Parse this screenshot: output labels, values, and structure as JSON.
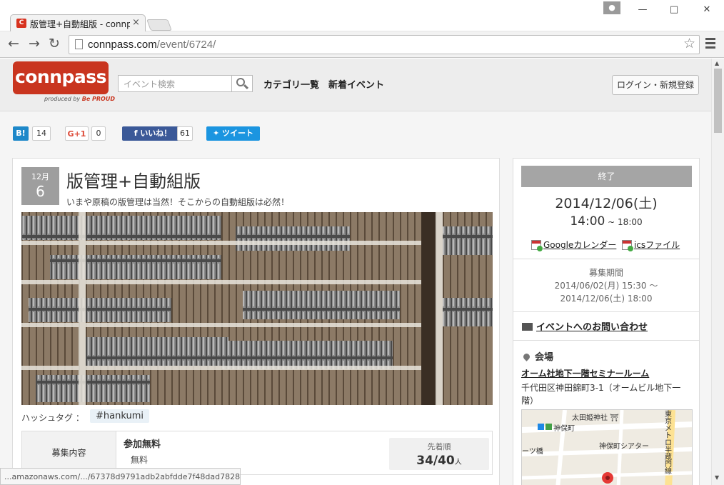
{
  "browser": {
    "tab_title": "版管理+自動組版 - connp",
    "tab_favicon": "C",
    "tab_close": "×",
    "url_domain": "connpass.com",
    "url_path": "/event/6724/",
    "status_url": "...amazonaws.com/.../67378d9791adb2abfdde7f48dad78284..."
  },
  "header": {
    "logo_text": "connpass",
    "logo_sub_prefix": "produced by",
    "logo_sub_brand": "Be PROUD",
    "search_placeholder": "イベント検索",
    "nav_categories": "カテゴリ一覧",
    "nav_new_events": "新着イベント",
    "login_label": "ログイン・新規登録"
  },
  "share": {
    "hatena_label": "B!",
    "hatena_count": "14",
    "gplus_label": "G+1",
    "gplus_count": "0",
    "facebook_label": "いいね！",
    "facebook_count": "61",
    "twitter_label": "ツイート"
  },
  "event": {
    "month": "12月",
    "day": "6",
    "title": "版管理+自動組版",
    "subtitle": "いまや原稿の版管理は当然！そこからの自動組版は必然！",
    "hashtag_label": "ハッシュタグ ：",
    "hashtag": "#hankumi",
    "recruit_label": "募集内容",
    "ticket_name": "参加無料",
    "ticket_price": "無料",
    "fcfs_label": "先着順",
    "fcfs_count": "34/40",
    "fcfs_unit": "人"
  },
  "side": {
    "status": "終了",
    "date": "2014/12/06(土)",
    "time_start": "14:00",
    "time_sep": " ~ ",
    "time_end": "18:00",
    "google_cal": "Googleカレンダー",
    "ics_file": "icsファイル",
    "period_label": "募集期間",
    "period_start": "2014/06/02(月) 15:30 ～",
    "period_end": "2014/12/06(土) 18:00",
    "contact": "イベントへのお問い合わせ",
    "venue_heading": "会場",
    "venue_name": "オーム社地下一階セミナールーム",
    "venue_address": "千代田区神田錦町3-1（オームビル地下一階）",
    "map_labels": {
      "shrine": "太田姫神社 ⛩",
      "station": "神保町",
      "theater": "神保町シアター",
      "bridge": "ーツ橋",
      "line": "東京メトロ半蔵門線"
    }
  }
}
